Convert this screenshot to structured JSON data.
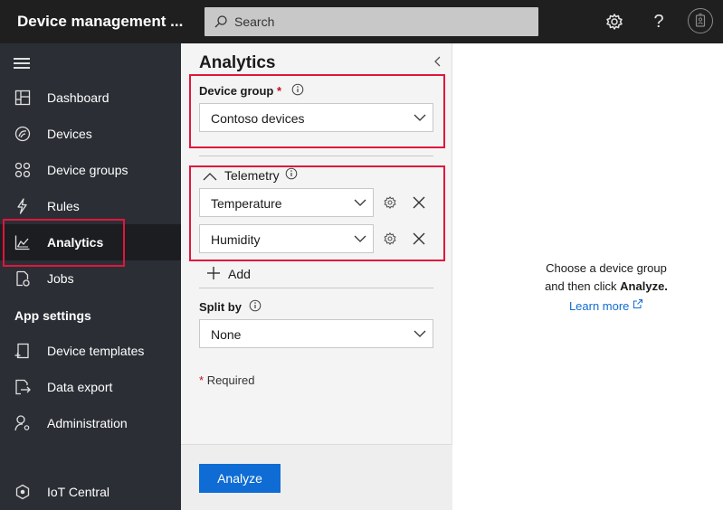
{
  "header": {
    "app_title": "Device management ...",
    "search_placeholder": "Search"
  },
  "sidebar": {
    "items": [
      {
        "label": "Dashboard",
        "icon": "dashboard-icon"
      },
      {
        "label": "Devices",
        "icon": "devices-icon"
      },
      {
        "label": "Device groups",
        "icon": "device-groups-icon"
      },
      {
        "label": "Rules",
        "icon": "rules-icon"
      },
      {
        "label": "Analytics",
        "icon": "analytics-icon",
        "active": true
      },
      {
        "label": "Jobs",
        "icon": "jobs-icon"
      }
    ],
    "section_label": "App settings",
    "settings_items": [
      {
        "label": "Device templates",
        "icon": "device-templates-icon"
      },
      {
        "label": "Data export",
        "icon": "data-export-icon"
      },
      {
        "label": "Administration",
        "icon": "administration-icon"
      }
    ],
    "footer_label": "IoT Central"
  },
  "panel": {
    "title": "Analytics",
    "device_group_label": "Device group",
    "required_star": "*",
    "device_group_value": "Contoso devices",
    "telemetry_label": "Telemetry",
    "telemetry_items": [
      "Temperature",
      "Humidity"
    ],
    "add_label": "Add",
    "split_by_label": "Split by",
    "split_by_value": "None",
    "required_note": "Required",
    "analyze_label": "Analyze"
  },
  "content": {
    "line1": "Choose a device group",
    "line2_prefix": "and then click ",
    "line2_bold": "Analyze.",
    "learn_more": "Learn more"
  },
  "colors": {
    "accent": "#0f6cd4",
    "highlight": "#e0163c",
    "sidebar_bg": "#2b2f35",
    "topbar_bg": "#1f1f1f"
  }
}
